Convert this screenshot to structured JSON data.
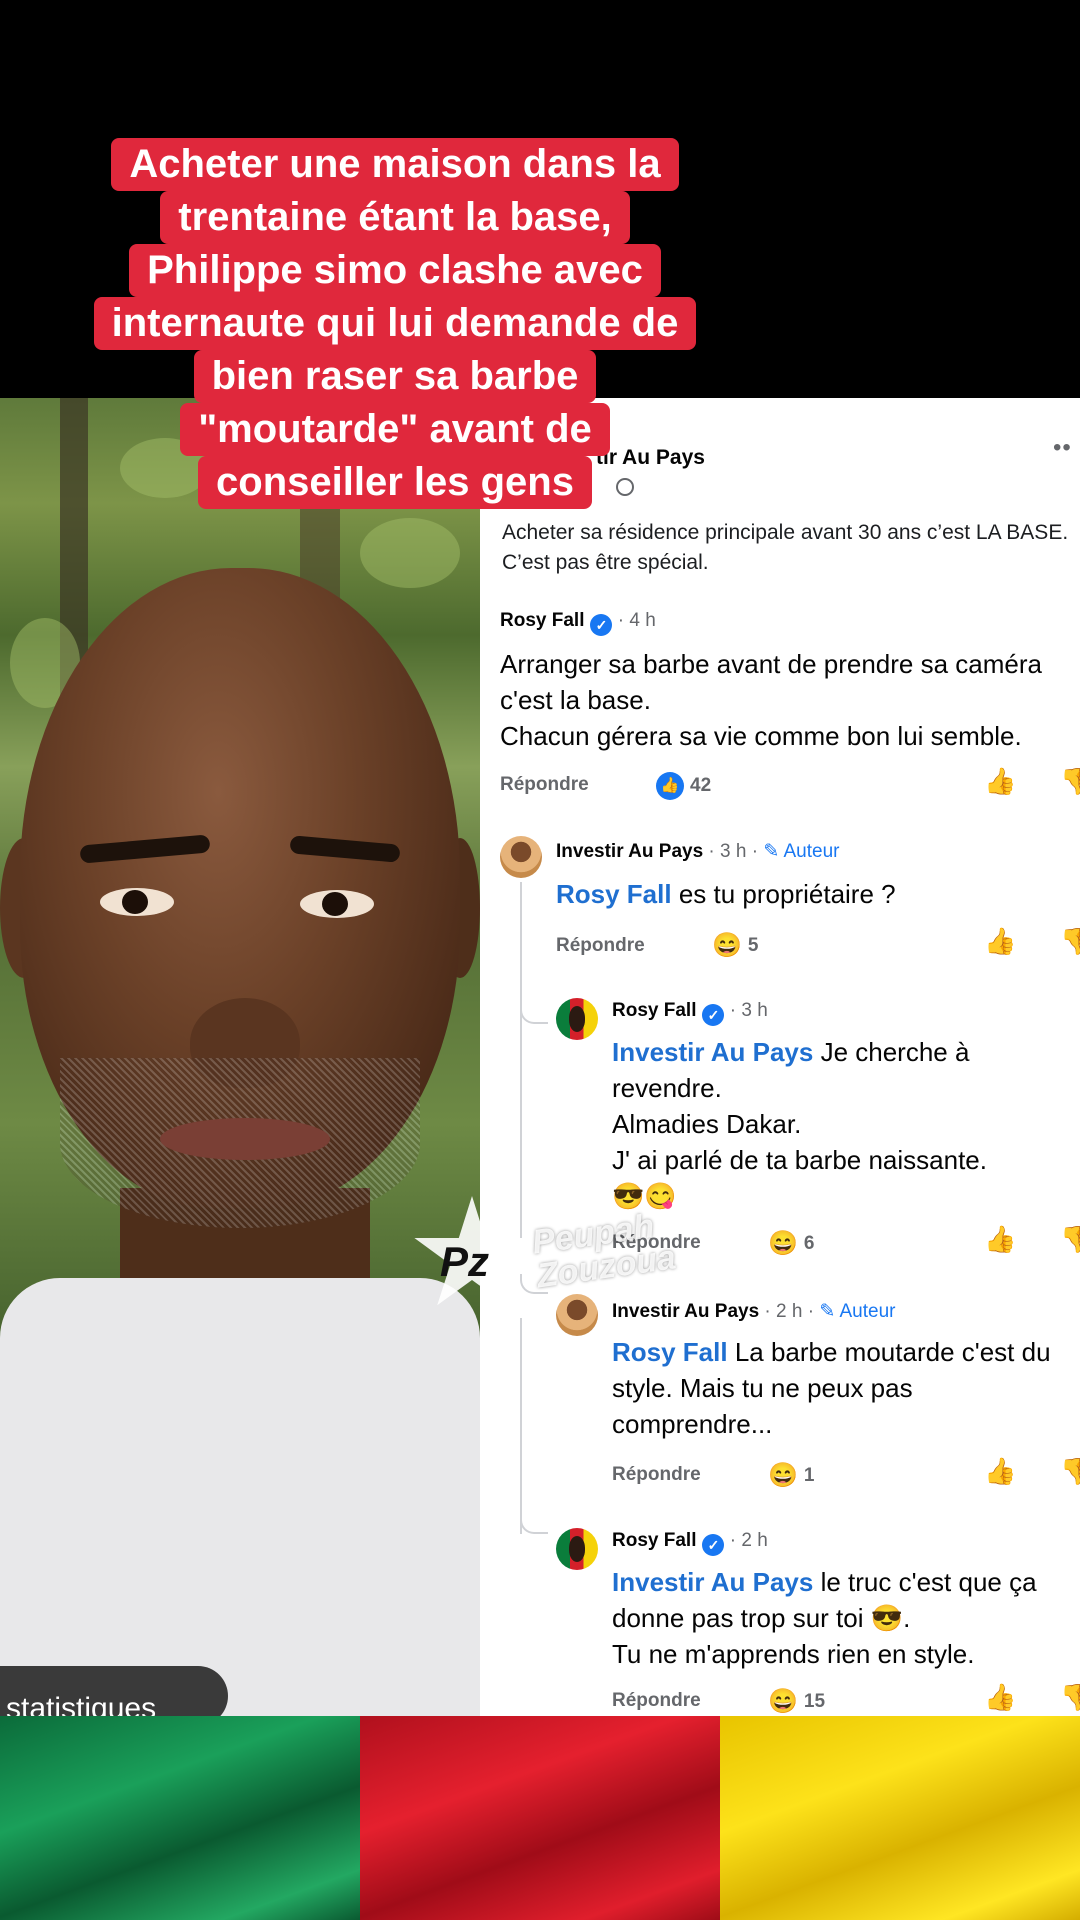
{
  "headline": {
    "lines": [
      "Acheter une maison dans la",
      "trentaine étant la base,",
      "Philippe simo clashe avec",
      "internaute qui lui demande de",
      "bien raser sa barbe",
      "\"moutarde\" avant de",
      "conseiller les gens"
    ],
    "background_color": "#e0283c"
  },
  "video": {
    "stats_label": "statistiques"
  },
  "post": {
    "author_partial": "tir Au Pays",
    "more_label": "••",
    "text": "Acheter sa résidence principale avant 30 ans c’est LA BASE. C’est pas être spécial."
  },
  "comments": [
    {
      "name": "Rosy Fall",
      "verified": "✓",
      "time": "· 4 h",
      "text": "Arranger sa barbe avant de prendre sa caméra c'est la base.\nChacun gérera sa vie comme bon lui semble.",
      "reply": "Répondre",
      "reaction_icon": "like",
      "reaction_count": "42"
    },
    {
      "name": "Investir Au Pays",
      "time": "· 3 h ·",
      "author_tag": "Auteur",
      "mention": "Rosy Fall",
      "text": " es tu propriétaire ?",
      "reply": "Répondre",
      "reaction_emoji": "😄",
      "reaction_count": "5"
    },
    {
      "name": "Rosy Fall",
      "verified": "✓",
      "time": "· 3 h",
      "mention": "Investir Au Pays",
      "text": " Je cherche à revendre.\nAlmadies Dakar.\nJ' ai parlé de ta barbe naissante.\n😎😋",
      "reply": "Répondre",
      "reaction_emoji": "😄",
      "reaction_count": "6"
    },
    {
      "name": "Investir Au Pays",
      "time": "· 2 h ·",
      "author_tag": "Auteur",
      "mention": "Rosy Fall",
      "text": " La barbe moutarde c'est du style. Mais tu ne peux pas comprendre...",
      "reply": "Répondre",
      "reaction_emoji": "😄",
      "reaction_count": "1"
    },
    {
      "name": "Rosy Fall",
      "verified": "✓",
      "time": "· 2 h",
      "mention": "Investir Au Pays",
      "text": " le truc c'est que ça donne pas trop sur toi 😎.\nTu ne m'apprends rien en style.",
      "reply": "Répondre",
      "reaction_emoji": "😄",
      "reaction_count": "15"
    }
  ],
  "watermark": {
    "logo": "Pz",
    "line1": "Peupah",
    "line2": "Zouzoua"
  },
  "flag_colors": [
    "#0b6b3a",
    "#e5202e",
    "#fde21a"
  ]
}
